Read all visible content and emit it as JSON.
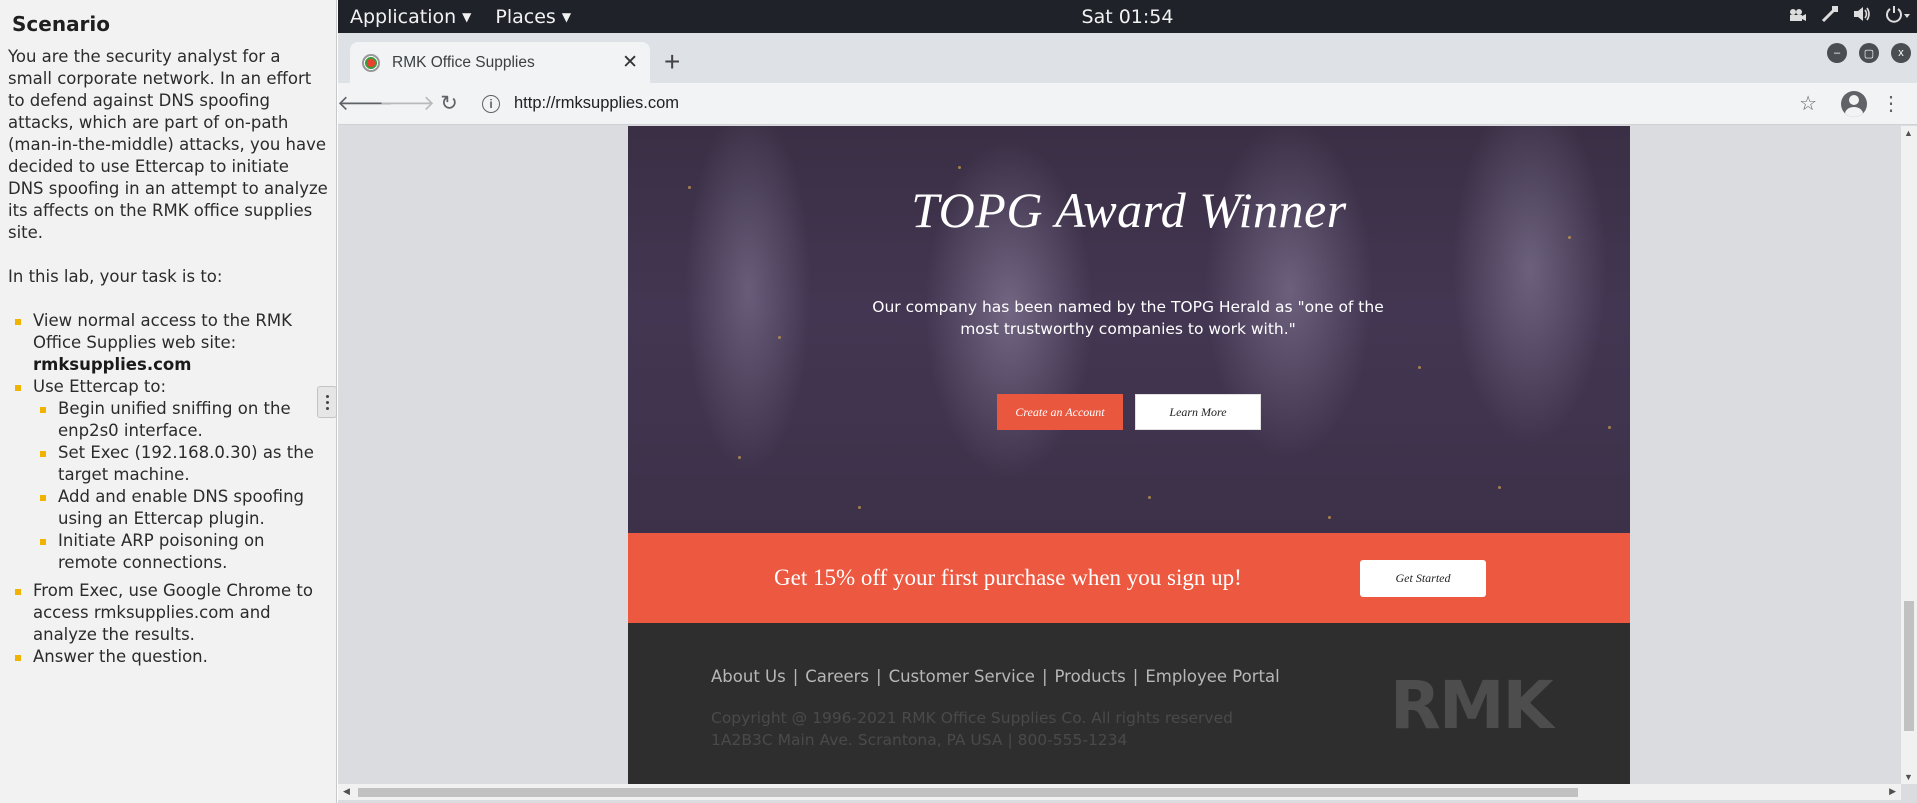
{
  "scenario": {
    "title": "Scenario",
    "intro": "You are the security analyst for a small corporate network. In an effort to defend against DNS spoofing attacks, which are part of on-path (man-in-the-middle) attacks, you have decided to use Ettercap to initiate DNS spoofing in an attempt to analyze its affects on the RMK office supplies site.",
    "task_intro": "In this lab, your task is to:",
    "task1_text": "View normal access to the RMK Office Supplies web site: ",
    "task1_bold": "rmksupplies.com",
    "task2": "Use Ettercap to:",
    "subtasks": [
      "Begin unified sniffing on the enp2s0 interface.",
      "Set Exec (192.168.0.30) as the target machine.",
      "Add and enable DNS spoofing using an Ettercap plugin.",
      "Initiate ARP poisoning on remote connections."
    ],
    "task3": "From Exec, use Google Chrome to access rmksupplies.com and analyze the results.",
    "task4": "Answer the question."
  },
  "topbar": {
    "application_menu": "Application",
    "places_menu": "Places",
    "clock": "Sat 01:54",
    "tray_icons": [
      "video-icon",
      "network-icon",
      "volume-icon",
      "power-icon"
    ]
  },
  "browser": {
    "tab_title": "RMK Office Supplies",
    "url": "http://rmksupplies.com"
  },
  "site": {
    "hero_title": "TOPG Award Winner",
    "hero_text": "Our company has been named by the TOPG Herald as \"one of the most trustworthy companies to work with.\"",
    "create_account": "Create an Account",
    "learn_more": "Learn More",
    "promo_text": "Get 15% off your first purchase when you sign up!",
    "get_started": "Get Started",
    "footer_links": [
      "About Us",
      "Careers",
      "Customer Service",
      "Products",
      "Employee Portal"
    ],
    "copyright": "Copyright @ 1996-2021 RMK Office Supplies Co. All rights reserved",
    "address": "1A2B3C Main Ave. Scrantona, PA USA | 800-555-1234",
    "logo": "RMK"
  },
  "colors": {
    "accent": "#ec5840",
    "footer_bg": "#2e2e2e",
    "hero_bg": "#3d3149",
    "bullet": "#f0b400"
  }
}
